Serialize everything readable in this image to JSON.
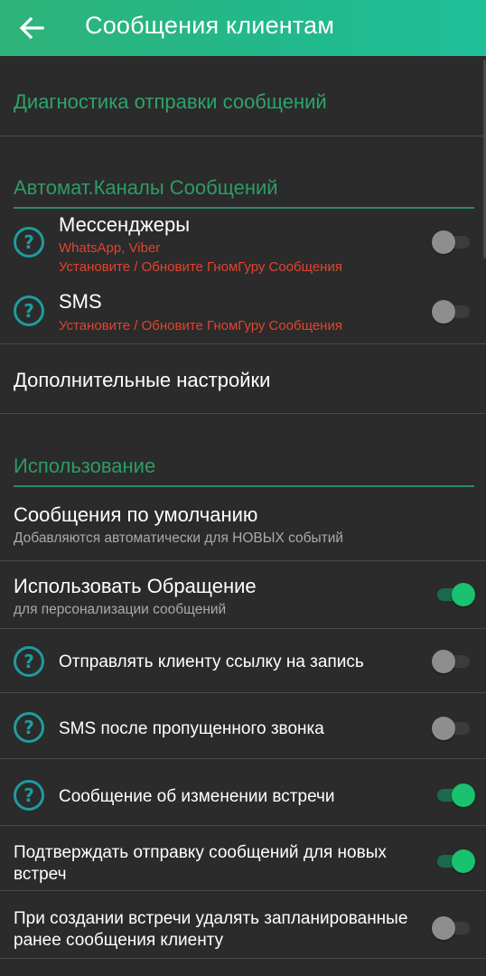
{
  "header": {
    "title": "Сообщения клиентам",
    "back_icon": "arrow-left-icon"
  },
  "diagnostics": {
    "label": "Диагностика отправки сообщений"
  },
  "auto_channels": {
    "header": "Автомат.Каналы Сообщений",
    "messengers": {
      "title": "Мессенджеры",
      "apps": "WhatsApp, Viber",
      "warning": "Установите / Обновите ГномГуру Сообщения",
      "enabled": false
    },
    "sms": {
      "title": "SMS",
      "warning": "Установите / Обновите ГномГуру Сообщения",
      "enabled": false
    }
  },
  "additional_settings": {
    "label": "Дополнительные настройки"
  },
  "usage": {
    "header": "Использование",
    "default_messages": {
      "title": "Сообщения по умолчанию",
      "subtitle": "Добавляются автоматически для НОВЫХ событий"
    },
    "use_address": {
      "title": "Использовать Обращение",
      "subtitle": "для персонализации сообщений",
      "enabled": true
    },
    "send_link": {
      "title": "Отправлять клиенту ссылку на запись",
      "enabled": false
    },
    "sms_missed_call": {
      "title": "SMS после пропущенного звонка",
      "enabled": false
    },
    "change_message": {
      "title": "Сообщение об изменении встречи",
      "enabled": true
    },
    "confirm_sending": {
      "title": "Подтверждать отправку сообщений для новых встреч",
      "enabled": true
    },
    "delete_scheduled": {
      "title": "При создании встречи удалять запланированные ранее сообщения клиенту",
      "enabled": false
    }
  },
  "colors": {
    "accent": "#2ea36a",
    "toggle_on": "#19c26e",
    "warning": "#e0442e",
    "help_icon": "#1e9c9f",
    "background": "#2b2b2b"
  }
}
